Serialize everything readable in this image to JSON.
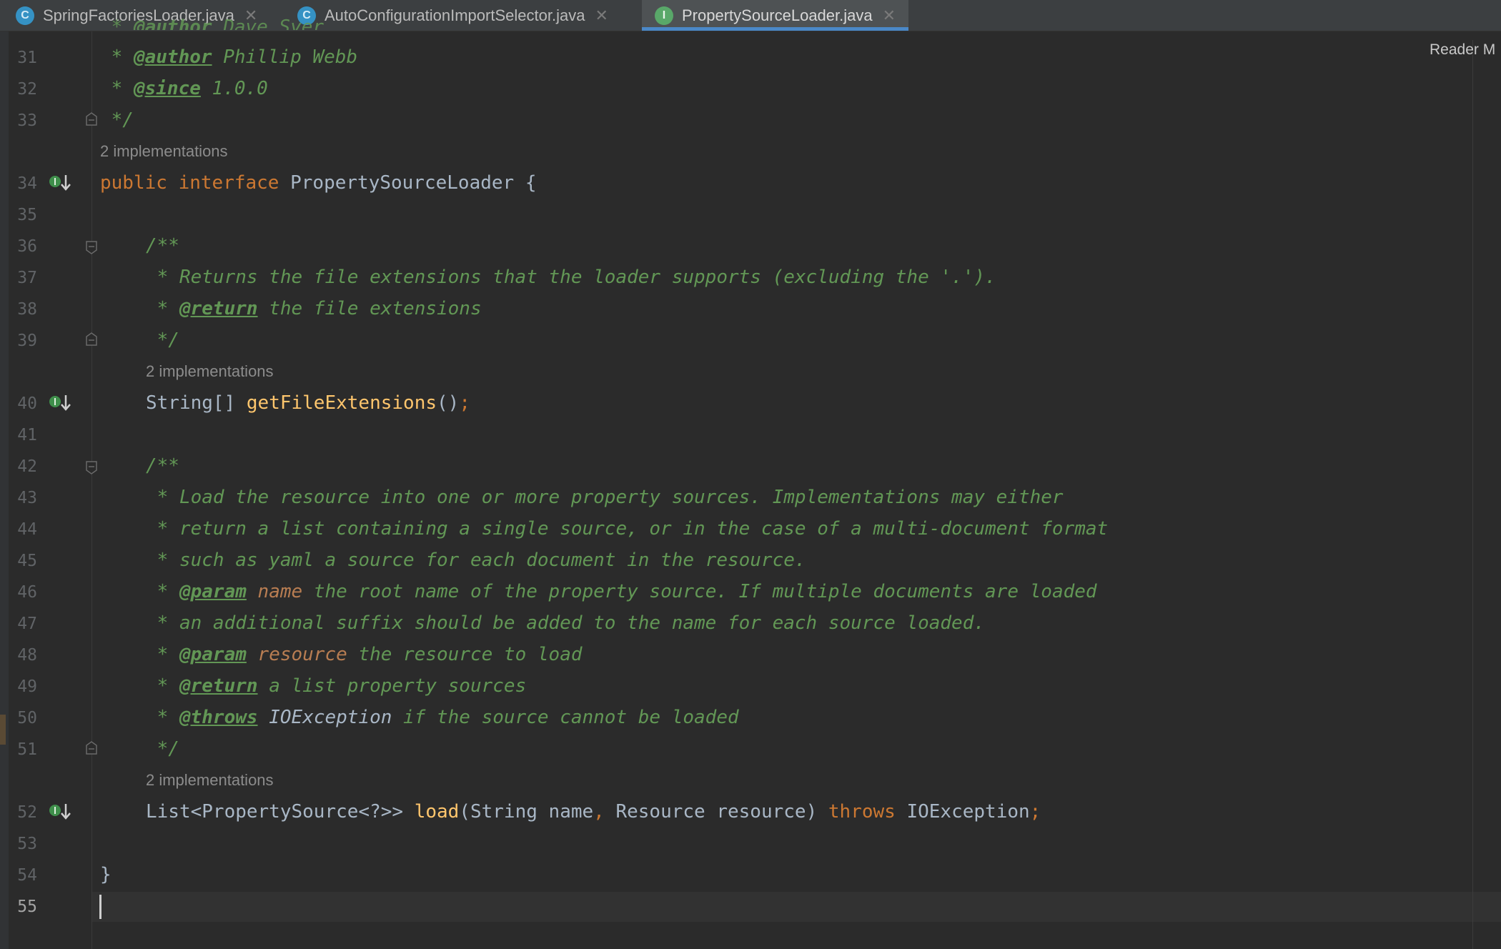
{
  "tabs": [
    {
      "label": "SpringFactoriesLoader.java",
      "icon": "class-icon",
      "active": false
    },
    {
      "label": "AutoConfigurationImportSelector.java",
      "icon": "class-icon",
      "active": false
    },
    {
      "label": "PropertySourceLoader.java",
      "icon": "interface-icon",
      "active": true
    }
  ],
  "tab_icon_letters": {
    "class": "C",
    "interface": "I"
  },
  "close_glyph": "✕",
  "reader_mode": "Reader M",
  "hints": {
    "interface_impls": "2 implementations",
    "method1_impls": "2 implementations",
    "method2_impls": "2 implementations"
  },
  "line_numbers": [
    "31",
    "32",
    "33",
    "34",
    "35",
    "36",
    "37",
    "38",
    "39",
    "40",
    "41",
    "42",
    "43",
    "44",
    "45",
    "46",
    "47",
    "48",
    "49",
    "50",
    "51",
    "52",
    "53",
    "54",
    "55"
  ],
  "code": {
    "l31": {
      "star": " * ",
      "tag": "@author",
      "rest": " Phillip Webb"
    },
    "l32": {
      "star": " * ",
      "tag": "@since",
      "rest": " 1.0.0"
    },
    "l33": " */",
    "l34": {
      "kw1": "public",
      "kw2": "interface",
      "name": "PropertySourceLoader",
      "brace": "{"
    },
    "l36": "/**",
    "l37": " * Returns the file extensions that the loader supports (excluding the '.').",
    "l38": {
      "star": " * ",
      "tag": "@return",
      "rest": " the file extensions"
    },
    "l39": " */",
    "l40": {
      "type": "String[] ",
      "fn": "getFileExtensions",
      "parens": "()",
      "semi": ";"
    },
    "l42": "/**",
    "l43": " * Load the resource into one or more property sources. Implementations may either",
    "l44": " * return a list containing a single source, or in the case of a multi-document format",
    "l45": " * such as yaml a source for each document in the resource.",
    "l46": {
      "star": " * ",
      "tag": "@param",
      "param": " name",
      "rest": " the root name of the property source. If multiple documents are loaded"
    },
    "l47": " * an additional suffix should be added to the name for each source loaded.",
    "l48": {
      "star": " * ",
      "tag": "@param",
      "param": " resource",
      "rest": " the resource to load"
    },
    "l49": {
      "star": " * ",
      "tag": "@return",
      "rest": " a list property sources"
    },
    "l50": {
      "star": " * ",
      "tag": "@throws",
      "type": " IOException",
      "rest": " if the source cannot be loaded"
    },
    "l51": " */",
    "l52": {
      "type": "List<PropertySource<?>> ",
      "fn": "load",
      "open": "(String name",
      "comma": ",",
      "mid": " Resource resource) ",
      "kw": "throws",
      "exc": " IOException",
      "semi": ";"
    },
    "l54": "}"
  },
  "colors": {
    "background": "#2b2b2b",
    "keyword": "#cc7832",
    "comment": "#629755",
    "function": "#ffc66d",
    "param": "#b87d52",
    "text": "#a9b7c6",
    "tab_underline": "#4a88c7"
  }
}
